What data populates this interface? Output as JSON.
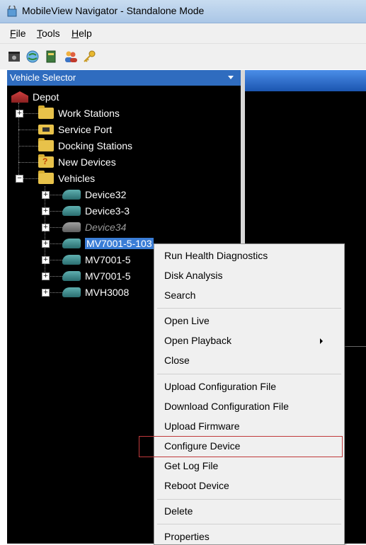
{
  "window": {
    "title": "MobileView Navigator - Standalone Mode"
  },
  "menu": [
    {
      "label_u": "F",
      "label_rest": "ile"
    },
    {
      "label_u": "T",
      "label_rest": "ools"
    },
    {
      "label_u": "H",
      "label_rest": "elp"
    }
  ],
  "toolbar": {
    "icons": [
      "camera-icon",
      "globe-icon",
      "book-icon",
      "users-icon",
      "key-icon"
    ]
  },
  "vehicle_selector": {
    "header": "Vehicle Selector"
  },
  "tree": {
    "root": "Depot",
    "folders": [
      "Work Stations",
      "Service Port",
      "Docking Stations",
      "New Devices",
      "Vehicles"
    ],
    "devices": [
      "Device32",
      "Device3-3",
      "Device34",
      "MV7001-5-103",
      "MV7001-5",
      "MV7001-5",
      "MVH3008"
    ],
    "selected_device": "MV7001-5-103",
    "inactive_device": "Device34"
  },
  "context_menu": {
    "items": [
      "Run Health Diagnostics",
      "Disk Analysis",
      "Search",
      "Open Live",
      "Open Playback",
      "Close",
      "Upload Configuration File",
      "Download Configuration File",
      "Upload Firmware",
      "Configure Device",
      "Get Log File",
      "Reboot Device",
      "Delete",
      "Properties"
    ],
    "highlighted": "Configure Device",
    "highlight_color": "#c0393b"
  },
  "colors": {
    "selector_header": "#2f6cbf",
    "selection": "#3a7dd6",
    "pane_bg": "#000000"
  }
}
